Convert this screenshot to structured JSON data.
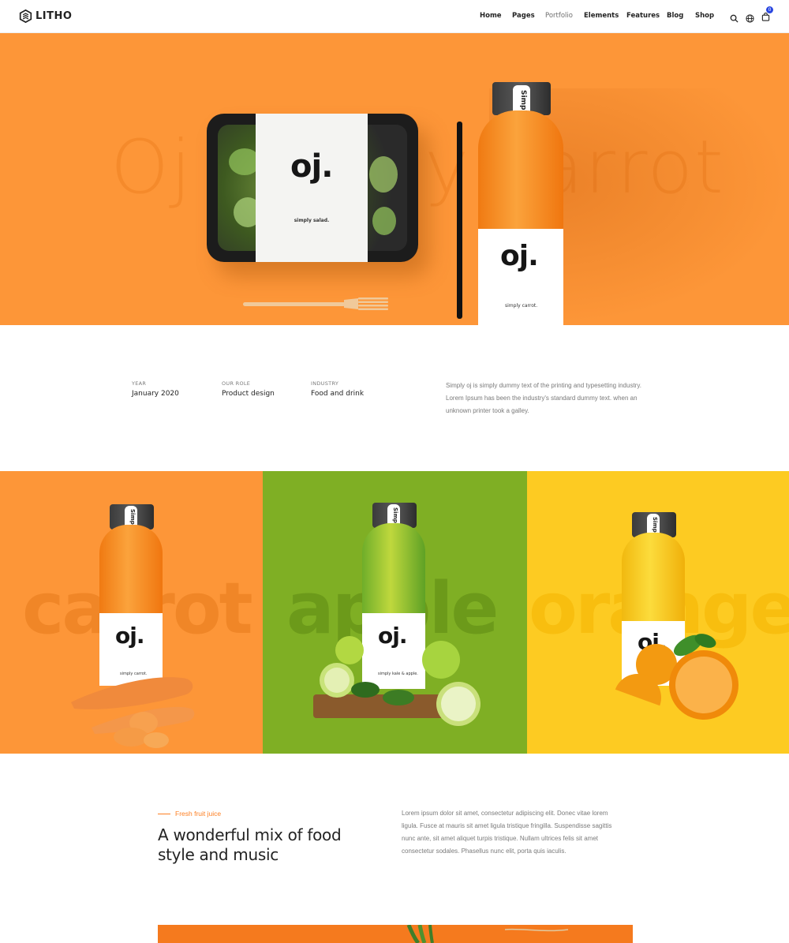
{
  "header": {
    "logo_text": "LITHO",
    "nav": [
      "Home",
      "Pages",
      "Portfolio",
      "Elements",
      "Features",
      "Blog",
      "Shop"
    ],
    "active_nav": "Portfolio",
    "cart_count": "0",
    "icons": [
      "search-icon",
      "globe-icon",
      "cart-icon"
    ]
  },
  "hero": {
    "background_word": "Oj simply carrot",
    "tray_logo": "oj.",
    "tray_caption": "simply salad.",
    "bottle_cap_text": "Simply",
    "bottle_logo": "oj.",
    "bottle_caption": "simply carrot.",
    "background_color": "#fd9638"
  },
  "info": {
    "year_label": "YEAR",
    "year_value": "January 2020",
    "role_label": "OUR ROLE",
    "role_value": "Product design",
    "industry_label": "INDUSTRY",
    "industry_value": "Food and drink",
    "description": "Simply oj is simply dummy text of the printing and typesetting industry. Lorem Ipsum has been the industry's standard dummy text. when an unknown printer took a galley."
  },
  "panels": [
    {
      "word": "carrot",
      "cap_text": "Simply",
      "logo": "oj.",
      "caption": "simply carrot.",
      "color": "#fd9638"
    },
    {
      "word": "apple",
      "cap_text": "Simply",
      "logo": "oj.",
      "caption": "simply kale & apple.",
      "color": "#7faf24"
    },
    {
      "word": "orange",
      "cap_text": "Simply",
      "logo": "oj.",
      "caption": "",
      "color": "#fdcb22"
    }
  ],
  "feature": {
    "tagline": "Fresh fruit juice",
    "heading": "A wonderful mix of food style and music",
    "description": "Lorem ipsum dolor sit amet, consectetur adipiscing elit. Donec vitae lorem ligula. Fusce at mauris sit amet ligula tristique fringilla. Suspendisse sagittis nunc ante, sit amet aliquet turpis tristique. Nullam ultrices felis sit amet consectetur sodales. Phasellus nunc elit, porta quis iaculis."
  },
  "colors": {
    "accent": "#fd7f22",
    "badge": "#2946e0"
  }
}
